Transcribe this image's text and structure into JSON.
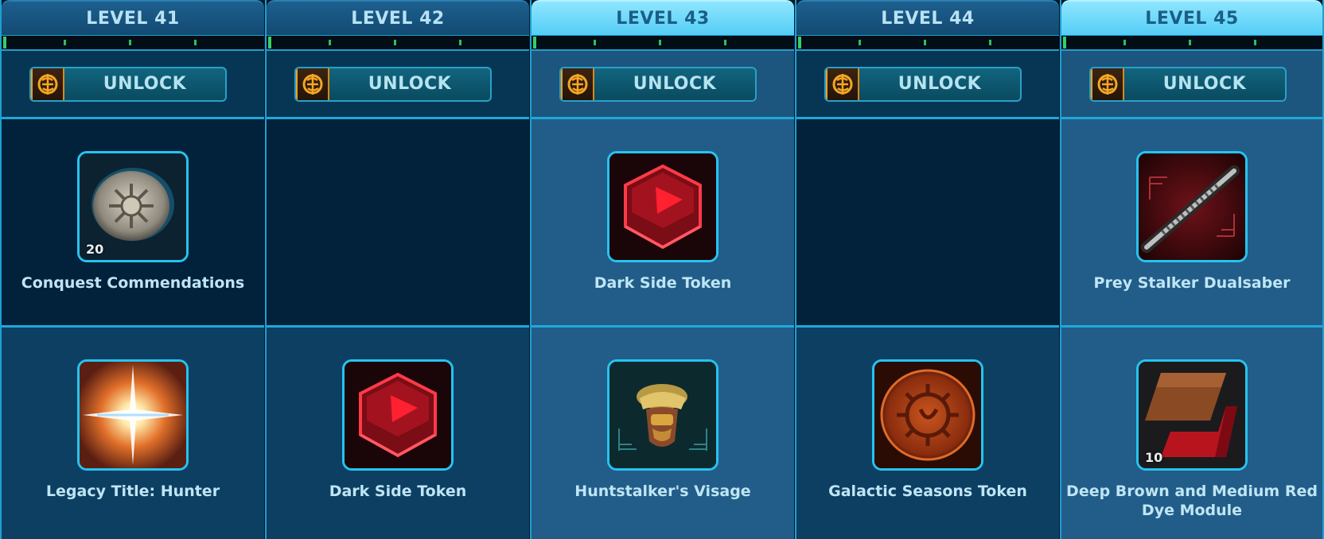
{
  "colors": {
    "accent": "#27c3ef",
    "header_highlight": "#8ee6ff",
    "progress_tick": "#2fbf5c",
    "coin": "#f0a020"
  },
  "levels": [
    {
      "label": "LEVEL 41",
      "unlock_label": "UNLOCK",
      "unlock_icon": "cartel-coin-icon",
      "rewards": [
        {
          "name": "Conquest Commendations",
          "icon": "conquest-commendation-icon",
          "quantity": "20"
        },
        {
          "name": "Legacy Title: Hunter",
          "icon": "legacy-title-icon",
          "quantity": ""
        }
      ]
    },
    {
      "label": "LEVEL 42",
      "unlock_label": "UNLOCK",
      "unlock_icon": "cartel-coin-icon",
      "rewards": [
        null,
        {
          "name": "Dark Side Token",
          "icon": "dark-side-token-icon",
          "quantity": ""
        }
      ]
    },
    {
      "label": "LEVEL 43",
      "unlock_label": "UNLOCK",
      "unlock_icon": "cartel-coin-icon",
      "rewards": [
        {
          "name": "Dark Side Token",
          "icon": "dark-side-token-icon",
          "quantity": ""
        },
        {
          "name": "Huntstalker's Visage",
          "icon": "helmet-icon",
          "quantity": ""
        }
      ]
    },
    {
      "label": "LEVEL 44",
      "unlock_label": "UNLOCK",
      "unlock_icon": "cartel-coin-icon",
      "rewards": [
        null,
        {
          "name": "Galactic Seasons Token",
          "icon": "galactic-seasons-token-icon",
          "quantity": ""
        }
      ]
    },
    {
      "label": "LEVEL 45",
      "unlock_label": "UNLOCK",
      "unlock_icon": "cartel-coin-icon",
      "rewards": [
        {
          "name": "Prey Stalker Dualsaber",
          "icon": "dualsaber-icon",
          "quantity": ""
        },
        {
          "name": "Deep Brown and Medium Red Dye Module",
          "icon": "dye-module-icon",
          "quantity": "10"
        }
      ]
    }
  ]
}
